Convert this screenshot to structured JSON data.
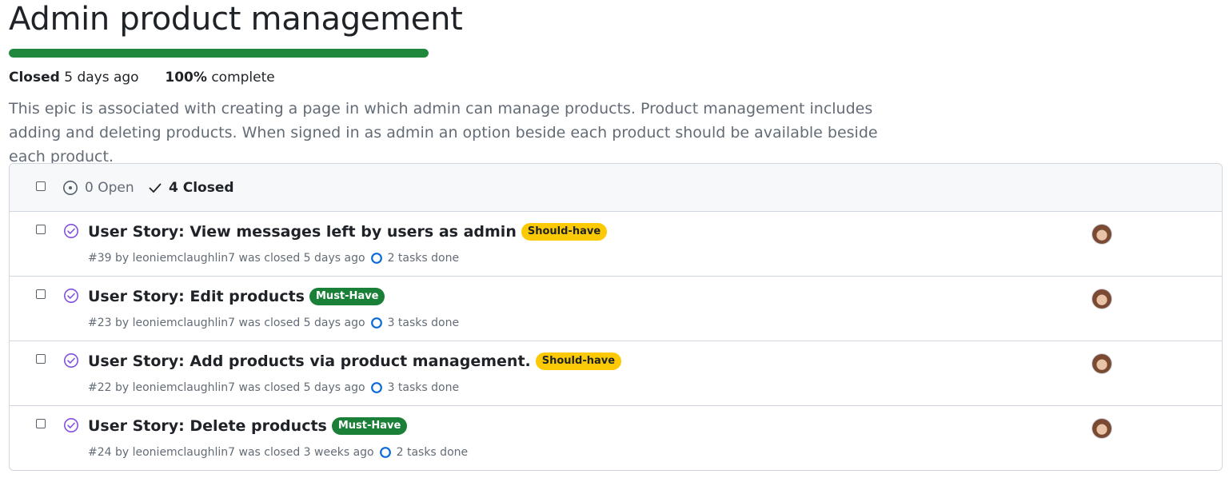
{
  "milestone": {
    "title": "Admin product management",
    "progress_fraction": 1.0,
    "status": "Closed",
    "closed_when": "5 days ago",
    "percent": "100%",
    "percent_suffix": "complete",
    "description": "This epic is associated with creating a page in which admin can manage products. Product management includes adding and deleting products. When signed in as admin an option beside each product should be available beside each product."
  },
  "filter": {
    "open_label": "0 Open",
    "closed_label": "4 Closed"
  },
  "colors": {
    "progress": "#1f883d",
    "closed_icon": "#8250df",
    "task_ring": "#0969da",
    "should_have_bg": "#fbca04",
    "should_have_fg": "#1f2328",
    "must_have_bg": "#1a7f37",
    "must_have_fg": "#ffffff"
  },
  "issues": [
    {
      "title": "User Story: View messages left by users as admin",
      "label": "Should-have",
      "label_type": "should",
      "meta": "#39 by leoniemclaughlin7 was closed 5 days ago",
      "tasks": "2 tasks done"
    },
    {
      "title": "User Story: Edit products",
      "label": "Must-Have",
      "label_type": "must",
      "meta": "#23 by leoniemclaughlin7 was closed 5 days ago",
      "tasks": "3 tasks done"
    },
    {
      "title": "User Story: Add products via product management.",
      "label": "Should-have",
      "label_type": "should",
      "meta": "#22 by leoniemclaughlin7 was closed 5 days ago",
      "tasks": "3 tasks done"
    },
    {
      "title": "User Story: Delete products",
      "label": "Must-Have",
      "label_type": "must",
      "meta": "#24 by leoniemclaughlin7 was closed 3 weeks ago",
      "tasks": "2 tasks done"
    }
  ]
}
